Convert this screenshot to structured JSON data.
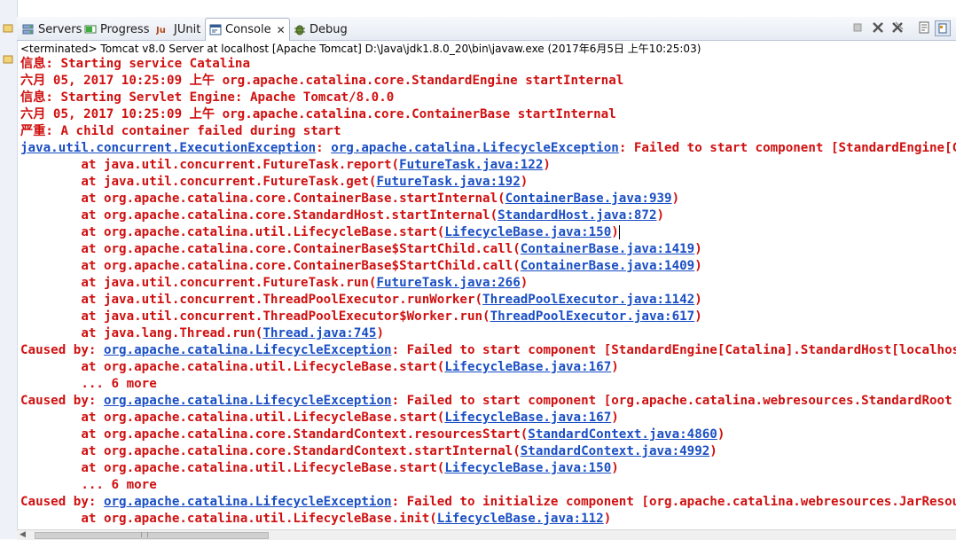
{
  "tabs": [
    {
      "label": "Servers",
      "icon": "servers-icon"
    },
    {
      "label": "Progress",
      "icon": "progress-icon"
    },
    {
      "label": "JUnit",
      "icon": "junit-icon"
    },
    {
      "label": "Console",
      "icon": "console-icon",
      "active": true,
      "close": "✕"
    },
    {
      "label": "Debug",
      "icon": "debug-icon"
    }
  ],
  "info_line": "<terminated> Tomcat v8.0 Server at localhost [Apache Tomcat] D:\\Java\\jdk1.8.0_20\\bin\\javaw.exe (2017年6月5日 上午10:25:03)",
  "colors": {
    "error_text": "#d01010",
    "link": "#1a4fc4"
  },
  "console_lines": [
    [
      {
        "t": "信息: Starting service Catalina"
      }
    ],
    [
      {
        "t": "六月 05, 2017 10:25:09 上午 org.apache.catalina.core.StandardEngine startInternal"
      }
    ],
    [
      {
        "t": "信息: Starting Servlet Engine: Apache Tomcat/8.0.0"
      }
    ],
    [
      {
        "t": "六月 05, 2017 10:25:09 上午 org.apache.catalina.core.ContainerBase startInternal"
      }
    ],
    [
      {
        "t": "严重: A child container failed during start"
      }
    ],
    [
      {
        "t": "java.util.concurrent.ExecutionException",
        "link": true
      },
      {
        "t": ": "
      },
      {
        "t": "org.apache.catalina.LifecycleException",
        "link": true
      },
      {
        "t": ": Failed to start component [StandardEngine[Catalina].StandardHost[localhost]"
      }
    ],
    [
      {
        "t": "        at java.util.concurrent.FutureTask.report("
      },
      {
        "t": "FutureTask.java:122",
        "link": true
      },
      {
        "t": ")"
      }
    ],
    [
      {
        "t": "        at java.util.concurrent.FutureTask.get("
      },
      {
        "t": "FutureTask.java:192",
        "link": true
      },
      {
        "t": ")"
      }
    ],
    [
      {
        "t": "        at org.apache.catalina.core.ContainerBase.startInternal("
      },
      {
        "t": "ContainerBase.java:939",
        "link": true
      },
      {
        "t": ")"
      }
    ],
    [
      {
        "t": "        at org.apache.catalina.core.StandardHost.startInternal("
      },
      {
        "t": "StandardHost.java:872",
        "link": true
      },
      {
        "t": ")"
      }
    ],
    [
      {
        "t": "        at org.apache.catalina.util.LifecycleBase.start("
      },
      {
        "t": "LifecycleBase.java:150",
        "link": true
      },
      {
        "t": ")"
      },
      {
        "cursor": true
      }
    ],
    [
      {
        "t": "        at org.apache.catalina.core.ContainerBase$StartChild.call("
      },
      {
        "t": "ContainerBase.java:1419",
        "link": true
      },
      {
        "t": ")"
      }
    ],
    [
      {
        "t": "        at org.apache.catalina.core.ContainerBase$StartChild.call("
      },
      {
        "t": "ContainerBase.java:1409",
        "link": true
      },
      {
        "t": ")"
      }
    ],
    [
      {
        "t": "        at java.util.concurrent.FutureTask.run("
      },
      {
        "t": "FutureTask.java:266",
        "link": true
      },
      {
        "t": ")"
      }
    ],
    [
      {
        "t": "        at java.util.concurrent.ThreadPoolExecutor.runWorker("
      },
      {
        "t": "ThreadPoolExecutor.java:1142",
        "link": true
      },
      {
        "t": ")"
      }
    ],
    [
      {
        "t": "        at java.util.concurrent.ThreadPoolExecutor$Worker.run("
      },
      {
        "t": "ThreadPoolExecutor.java:617",
        "link": true
      },
      {
        "t": ")"
      }
    ],
    [
      {
        "t": "        at java.lang.Thread.run("
      },
      {
        "t": "Thread.java:745",
        "link": true
      },
      {
        "t": ")"
      }
    ],
    [
      {
        "t": "Caused by: "
      },
      {
        "t": "org.apache.catalina.LifecycleException",
        "link": true
      },
      {
        "t": ": Failed to start component [StandardEngine[Catalina].StandardHost[localhost]"
      }
    ],
    [
      {
        "t": "        at org.apache.catalina.util.LifecycleBase.start("
      },
      {
        "t": "LifecycleBase.java:167",
        "link": true
      },
      {
        "t": ")"
      }
    ],
    [
      {
        "t": "        ... 6 more"
      }
    ],
    [
      {
        "t": "Caused by: "
      },
      {
        "t": "org.apache.catalina.LifecycleException",
        "link": true
      },
      {
        "t": ": Failed to start component [org.apache.catalina.webresources.StandardRoot"
      }
    ],
    [
      {
        "t": "        at org.apache.catalina.util.LifecycleBase.start("
      },
      {
        "t": "LifecycleBase.java:167",
        "link": true
      },
      {
        "t": ")"
      }
    ],
    [
      {
        "t": "        at org.apache.catalina.core.StandardContext.resourcesStart("
      },
      {
        "t": "StandardContext.java:4860",
        "link": true
      },
      {
        "t": ")"
      }
    ],
    [
      {
        "t": "        at org.apache.catalina.core.StandardContext.startInternal("
      },
      {
        "t": "StandardContext.java:4992",
        "link": true
      },
      {
        "t": ")"
      }
    ],
    [
      {
        "t": "        at org.apache.catalina.util.LifecycleBase.start("
      },
      {
        "t": "LifecycleBase.java:150",
        "link": true
      },
      {
        "t": ")"
      }
    ],
    [
      {
        "t": "        ... 6 more"
      }
    ],
    [
      {
        "t": "Caused by: "
      },
      {
        "t": "org.apache.catalina.LifecycleException",
        "link": true
      },
      {
        "t": ": Failed to initialize component [org.apache.catalina.webresources.JarResourceSet"
      }
    ],
    [
      {
        "t": "        at org.apache.catalina.util.LifecycleBase.init("
      },
      {
        "t": "LifecycleBase.java:112",
        "link": true
      },
      {
        "t": ")"
      }
    ]
  ]
}
